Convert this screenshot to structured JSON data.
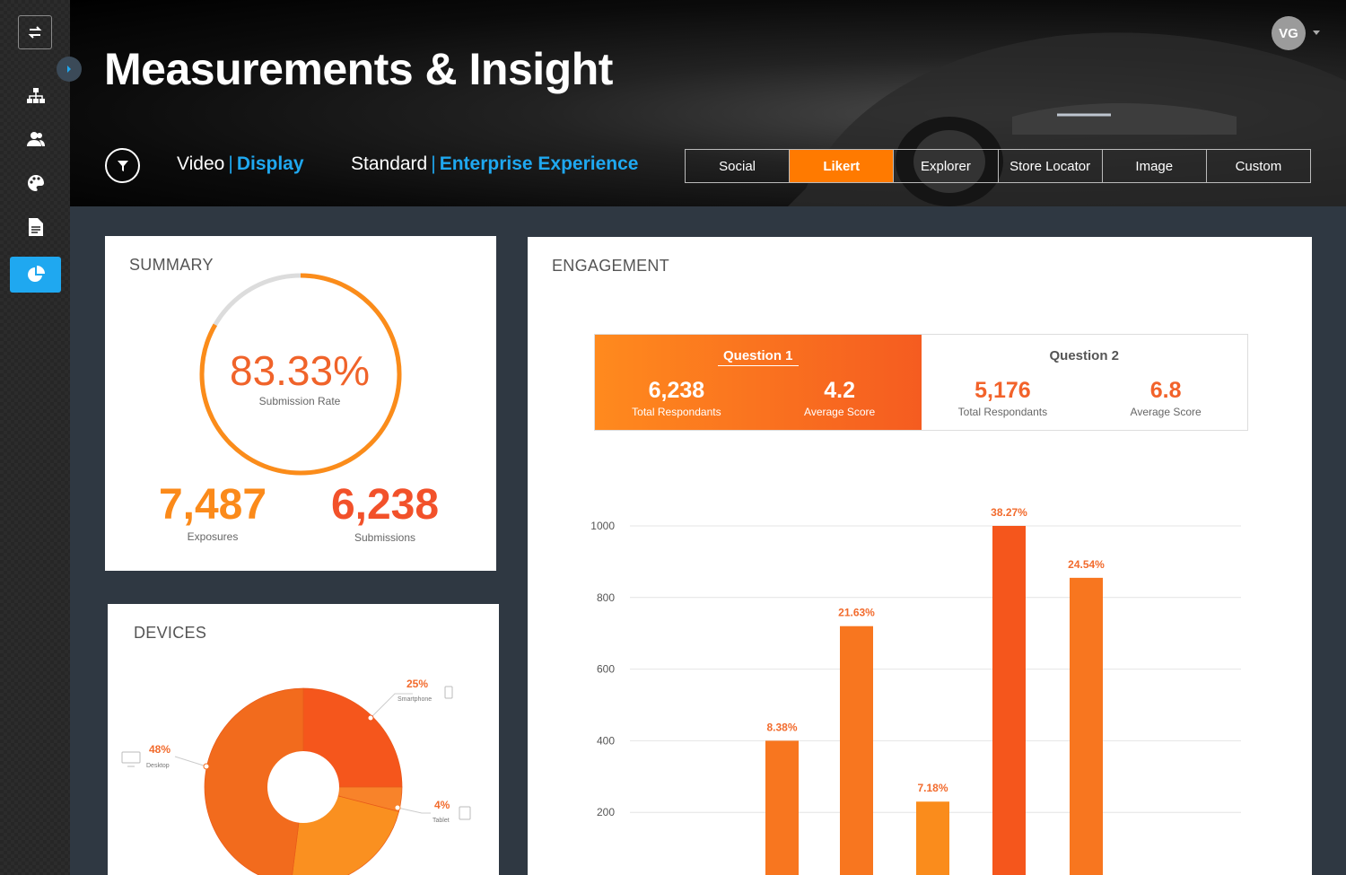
{
  "header": {
    "title": "Measurements & Insight",
    "avatar_initials": "VG",
    "media_type": "Video",
    "media_subtype": "Display",
    "format": "Standard",
    "format_subtype": "Enterprise Experience",
    "tabs": [
      "Social",
      "Likert",
      "Explorer",
      "Store Locator",
      "Image",
      "Custom"
    ],
    "active_tab": "Likert"
  },
  "sidebar": {
    "items": [
      "swap-icon",
      "sitemap-icon",
      "users-icon",
      "palette-icon",
      "document-icon",
      "pie-chart-icon"
    ],
    "active": "pie-chart-icon"
  },
  "summary": {
    "title": "SUMMARY",
    "rate_value": "83.33%",
    "rate_label": "Submission Rate",
    "rate_fraction": 0.8333,
    "exposures_value": "7,487",
    "exposures_label": "Exposures",
    "submissions_value": "6,238",
    "submissions_label": "Submissions"
  },
  "devices": {
    "title": "DEVICES",
    "segments": [
      {
        "pct": "48%",
        "label": "Desktop",
        "value": 48,
        "color": "#f26b1d"
      },
      {
        "pct": "25%",
        "label": "Smartphone",
        "value": 25,
        "color": "#f5561c"
      },
      {
        "pct": "4%",
        "label": "Tablet",
        "value": 4,
        "color": "#f8832a"
      }
    ]
  },
  "engagement": {
    "title": "ENGAGEMENT",
    "questions": [
      {
        "title": "Question 1",
        "total_value": "6,238",
        "total_label": "Total Respondants",
        "avg_value": "4.2",
        "avg_label": "Average Score"
      },
      {
        "title": "Question 2",
        "total_value": "5,176",
        "total_label": "Total Respondants",
        "avg_value": "6.8",
        "avg_label": "Average Score"
      }
    ]
  },
  "chart_data": {
    "type": "bar",
    "title": "",
    "xlabel": "",
    "ylabel": "",
    "ylim": [
      0,
      1000
    ],
    "yticks": [
      200,
      400,
      600,
      800,
      1000
    ],
    "grid": true,
    "values": [
      400,
      720,
      230,
      1000,
      855
    ],
    "labels": [
      "8.38%",
      "21.63%",
      "7.18%",
      "38.27%",
      "24.54%"
    ],
    "colors": {
      "bar_a": "#f8761f",
      "bar_b": "#f5561c",
      "bar_light": "#fa8c1c",
      "label": "#f26b2d"
    }
  }
}
